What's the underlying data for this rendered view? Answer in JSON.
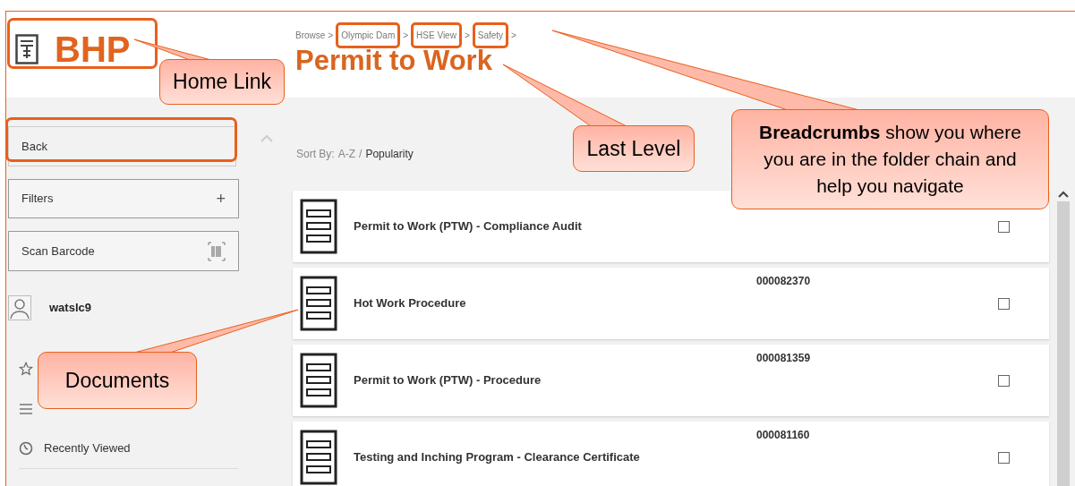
{
  "logo": {
    "text": "BHP"
  },
  "breadcrumbs": {
    "root": {
      "label": "Browse",
      "separator": ">"
    },
    "items": [
      {
        "label": "Olympic Dam",
        "separator": ">"
      },
      {
        "label": "HSE View",
        "separator": ">"
      },
      {
        "label": "Safety",
        "separator": ">"
      }
    ]
  },
  "page_title": "Permit to Work",
  "sidebar": {
    "items": [
      {
        "kind": "button",
        "label": "Back"
      },
      {
        "kind": "expander",
        "label": "Filters",
        "icon_text": "+"
      },
      {
        "kind": "scan",
        "label": "Scan Barcode"
      },
      {
        "kind": "user",
        "label": "watslc9"
      },
      {
        "kind": "star"
      },
      {
        "kind": "list"
      },
      {
        "kind": "recent",
        "label": "Recently Viewed"
      }
    ]
  },
  "sort": {
    "label": "Sort By:",
    "options": [
      {
        "label": "A-Z",
        "selected": false
      },
      {
        "label": "Popularity",
        "selected": true
      }
    ],
    "separator": "/"
  },
  "documents": [
    {
      "title": "Permit to Work (PTW) - Compliance Audit",
      "checked": false
    },
    {
      "number": "000082370",
      "title": "Hot Work Procedure",
      "checked": false
    },
    {
      "number": "000081359",
      "title": "Permit to Work (PTW) - Procedure",
      "checked": false
    },
    {
      "number": "000081160",
      "title": "Testing and Inching Program - Clearance Certificate",
      "checked": false
    }
  ],
  "callouts": [
    {
      "kind": "home",
      "text": "Home Link"
    },
    {
      "kind": "level",
      "text": "Last Level"
    },
    {
      "kind": "crumbs",
      "text": "**Breadcrumbs** show you where you are in the folder chain and help you navigate"
    },
    {
      "kind": "docs",
      "text": "Documents"
    }
  ]
}
